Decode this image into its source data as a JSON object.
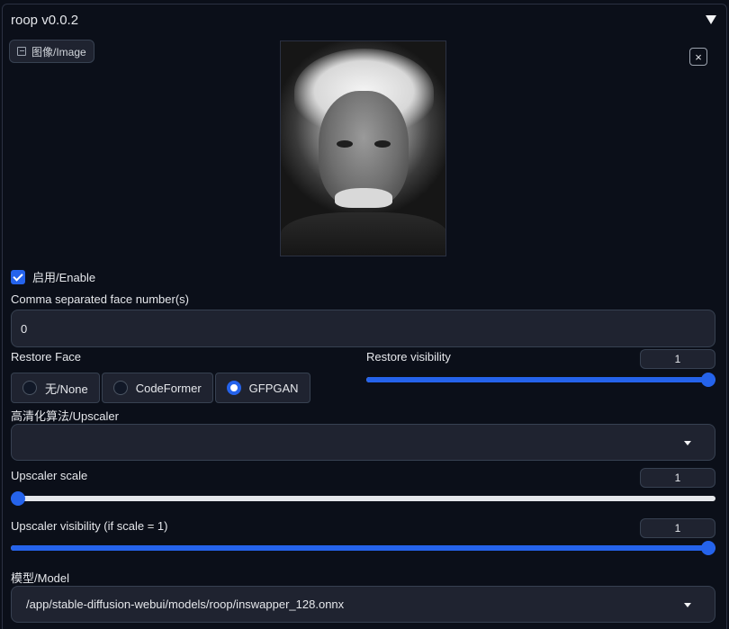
{
  "header": {
    "title": "roop v0.0.2"
  },
  "image": {
    "label": "图像/Image",
    "clear_symbol": "×",
    "label_icon": "image-icon"
  },
  "enable": {
    "label": "启用/Enable",
    "checked": true
  },
  "faces": {
    "label": "Comma separated face number(s)",
    "value": "0"
  },
  "restore_face": {
    "label": "Restore Face",
    "options": [
      {
        "label": "无/None",
        "selected": false
      },
      {
        "label": "CodeFormer",
        "selected": false
      },
      {
        "label": "GFPGAN",
        "selected": true
      }
    ]
  },
  "restore_visibility": {
    "label": "Restore visibility",
    "value": "1",
    "fraction": 1.0
  },
  "upscaler": {
    "label": "高清化算法/Upscaler",
    "value": ""
  },
  "upscaler_scale": {
    "label": "Upscaler scale",
    "value": "1",
    "fraction": 0.0
  },
  "upscaler_visibility": {
    "label": "Upscaler visibility (if scale = 1)",
    "value": "1",
    "fraction": 1.0
  },
  "model": {
    "label": "模型/Model",
    "value": "/app/stable-diffusion-webui/models/roop/inswapper_128.onnx"
  },
  "colors": {
    "accent": "#2563eb",
    "background": "#0b0f19",
    "input_bg": "#1f2330",
    "border": "#374151"
  }
}
